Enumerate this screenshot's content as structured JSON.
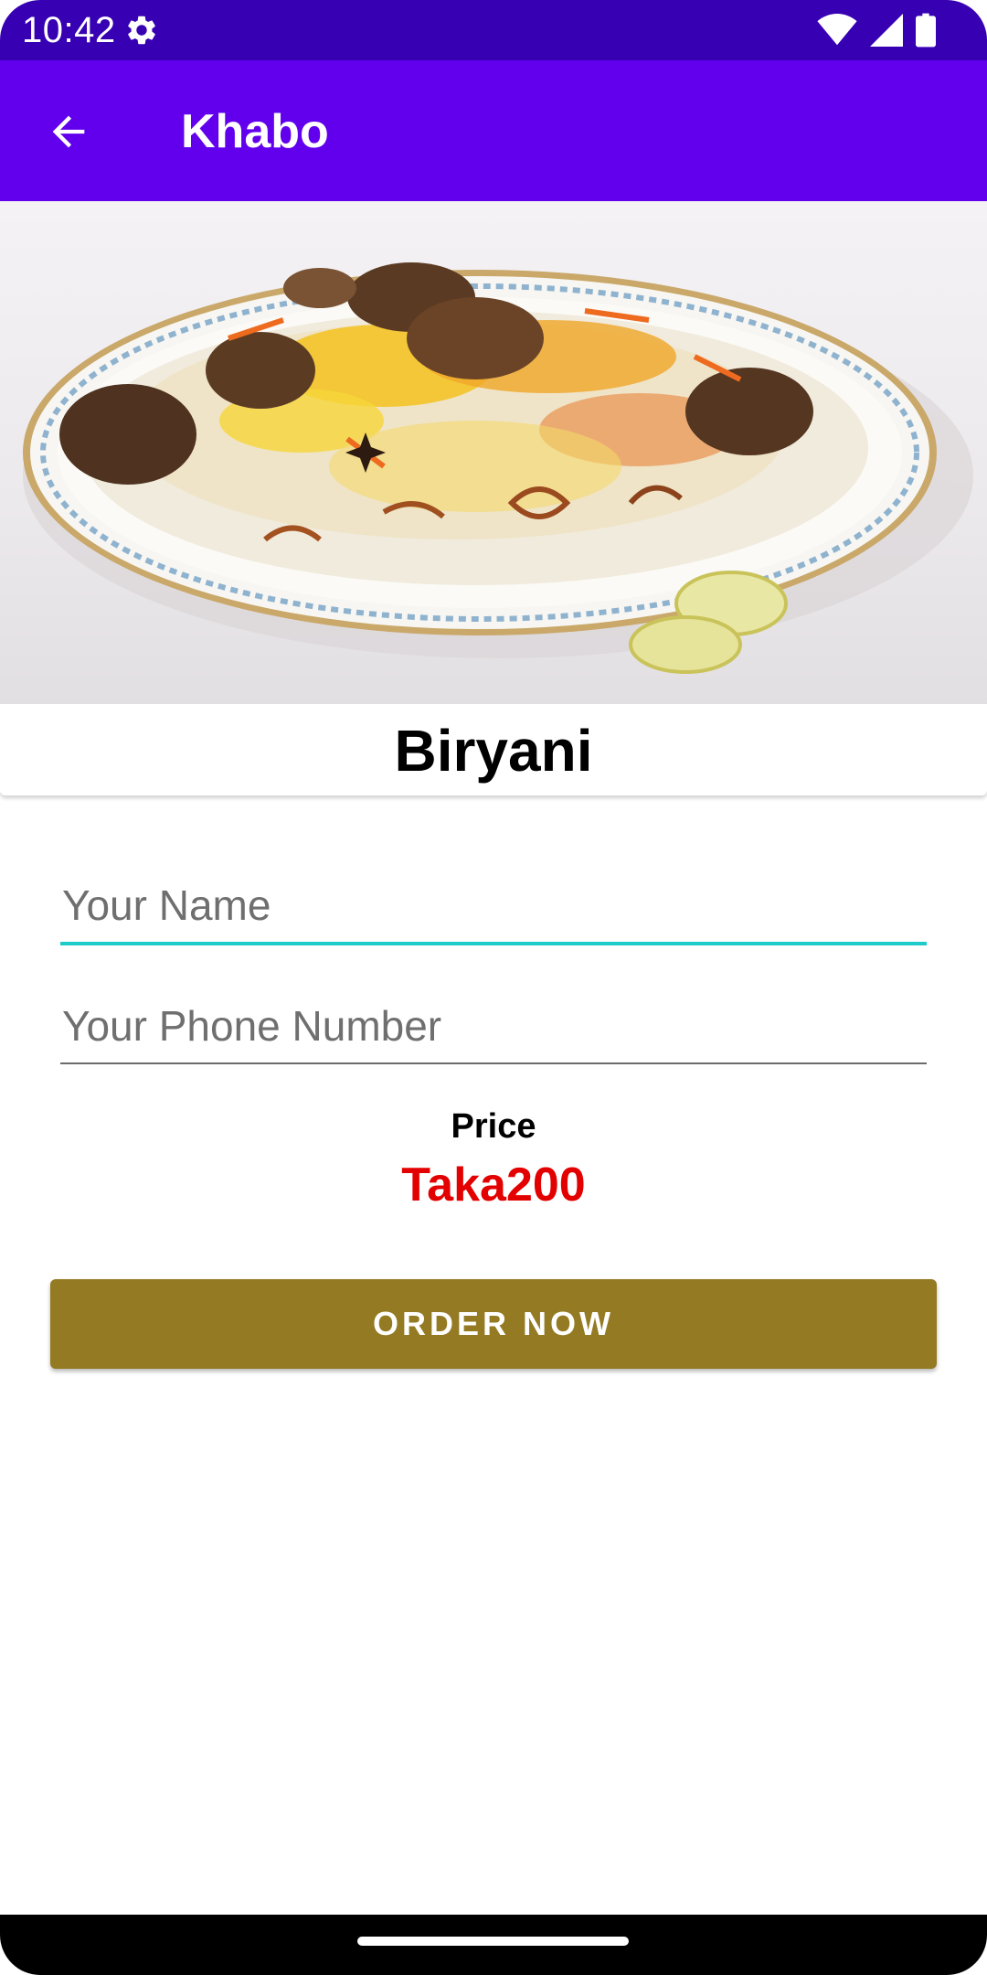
{
  "status_bar": {
    "time": "10:42",
    "icons": [
      "gear-icon",
      "wifi-icon",
      "signal-icon",
      "battery-icon"
    ]
  },
  "app_bar": {
    "title": "Khabo",
    "back_icon": "arrow-left-icon"
  },
  "food": {
    "name": "Biryani"
  },
  "form": {
    "name_placeholder": "Your Name",
    "phone_placeholder": "Your Phone Number"
  },
  "price": {
    "label": "Price",
    "value": "Taka200"
  },
  "actions": {
    "order_label": "ORDER NOW"
  },
  "colors": {
    "status_bar": "#3700b3",
    "app_bar": "#6200ee",
    "focus_underline": "#1fcbc8",
    "price_text": "#e30000",
    "order_button": "#947a23"
  }
}
